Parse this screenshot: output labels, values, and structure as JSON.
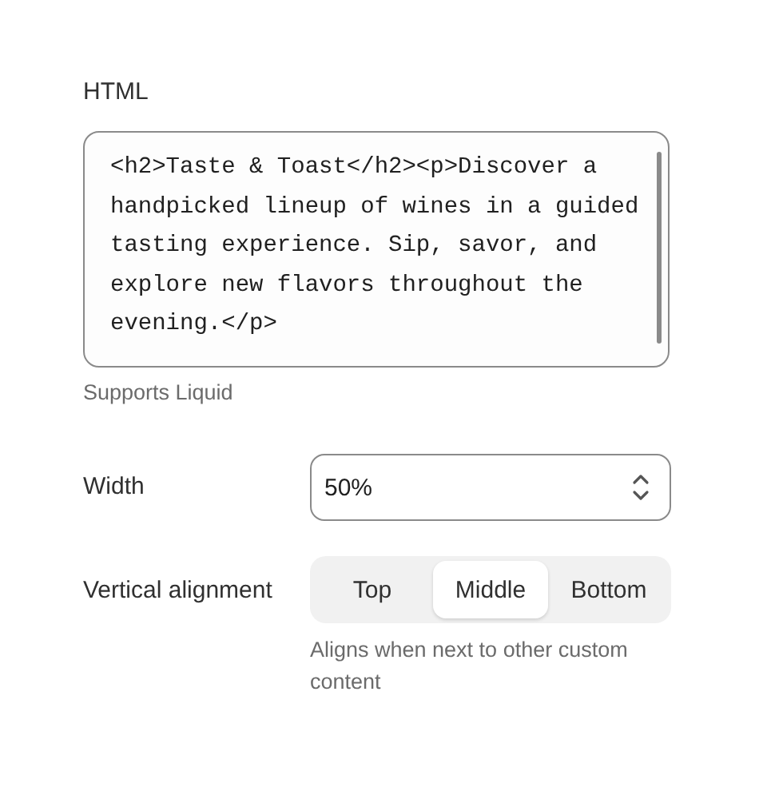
{
  "html_field": {
    "label": "HTML",
    "value": "<h2>Taste & Toast</h2><p>Discover a handpicked lineup of wines in a guided tasting experience. Sip, savor, and explore new flavors throughout the evening.</p>",
    "help": "Supports Liquid"
  },
  "width_field": {
    "label": "Width",
    "value": "50%"
  },
  "alignment_field": {
    "label": "Vertical alignment",
    "options": [
      {
        "label": "Top",
        "selected": false
      },
      {
        "label": "Middle",
        "selected": true
      },
      {
        "label": "Bottom",
        "selected": false
      }
    ],
    "help": "Aligns when next to other custom content"
  }
}
